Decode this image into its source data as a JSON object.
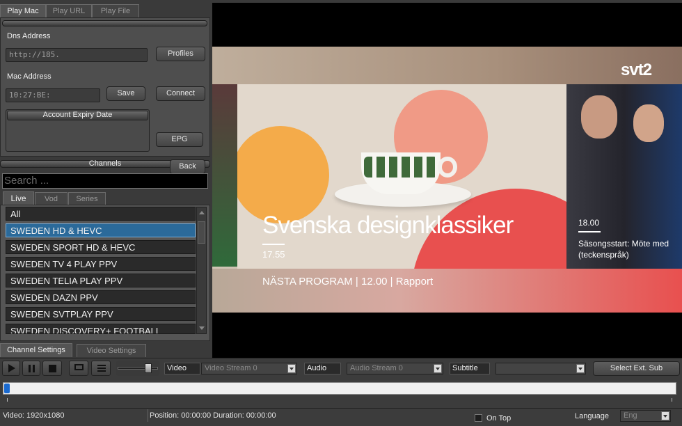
{
  "tabs": {
    "play_mac": "Play Mac",
    "play_url": "Play URL",
    "play_file": "Play File"
  },
  "account": {
    "dns_label": "Dns Address",
    "dns_value": "http://185.",
    "profiles_button": "Profiles",
    "mac_label": "Mac Address",
    "mac_value": "10:27:BE:",
    "save_button": "Save",
    "connect_button": "Connect",
    "expiry_label": "Account Expiry Date",
    "epg_button": "EPG"
  },
  "channels": {
    "header": "Channels",
    "back_button": "Back",
    "search_placeholder": "Search ...",
    "tabs": {
      "live": "Live",
      "vod": "Vod",
      "series": "Series"
    },
    "items": [
      "All",
      "SWEDEN HD & HEVC",
      "SWEDEN SPORT HD & HEVC",
      "SWEDEN TV 4 PLAY PPV",
      "SWEDEN TELIA PLAY PPV",
      "SWEDEN DAZN PPV",
      "SWEDEN SVTPLAY PPV",
      "SWEDEN DISCOVERY+ FOOTBALL"
    ],
    "selected_index": 1
  },
  "bottom_tabs": {
    "channel_settings": "Channel Settings",
    "video_settings": "Video Settings"
  },
  "video": {
    "logo": "svt2",
    "program_title": "Svenska designklassiker",
    "program_time": "17.55",
    "next_program": "NÄSTA PROGRAM | 12.00 | Rapport",
    "side_time": "18.00",
    "side_text_1": "Säsongsstart: Möte med",
    "side_text_2": "(teckenspråk)"
  },
  "controls": {
    "video_label": "Video",
    "video_stream": "Video Stream 0",
    "audio_label": "Audio",
    "audio_stream": "Audio Stream 0",
    "subtitle_label": "Subtitle",
    "subtitle_value": "",
    "ext_sub_button": "Select Ext. Sub",
    "volume": 0.82,
    "progress": 0.0
  },
  "status": {
    "video_info": "Video: 1920x1080",
    "position": "Position: 00:00:00 Duration: 00:00:00",
    "on_top": "On Top",
    "language_label": "Language",
    "language_value": "Eng"
  },
  "colors": {
    "accent": "#2b6a9a",
    "svt_red": "#e8504f",
    "cup_orange": "#f4ab4a",
    "cup_pink": "#f09a86"
  }
}
